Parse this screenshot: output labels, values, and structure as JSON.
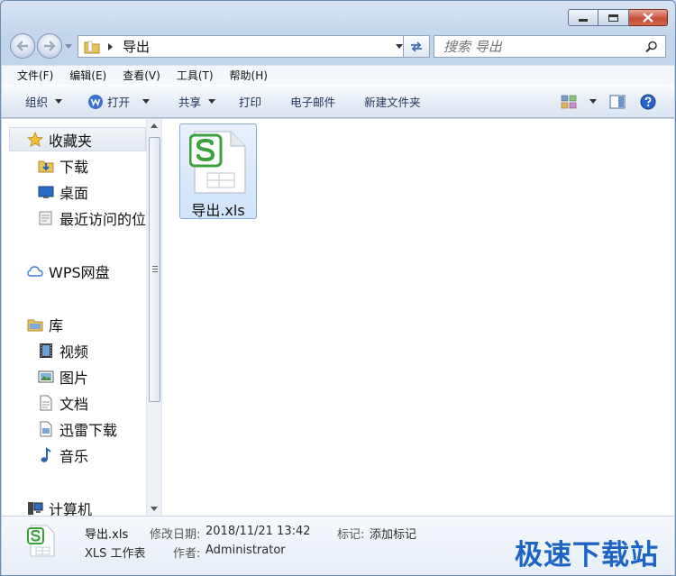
{
  "address": {
    "path": "导出"
  },
  "search": {
    "placeholder": "搜索 导出"
  },
  "menu": [
    "文件(F)",
    "编辑(E)",
    "查看(V)",
    "工具(T)",
    "帮助(H)"
  ],
  "toolbar": {
    "organize": "组织",
    "open": "打开",
    "share": "共享",
    "print": "打印",
    "email": "电子邮件",
    "new_folder": "新建文件夹"
  },
  "nav": {
    "favorites": "收藏夹",
    "downloads": "下载",
    "desktop": "桌面",
    "recent": "最近访问的位",
    "wps_cloud": "WPS网盘",
    "libraries": "库",
    "videos": "视频",
    "pictures": "图片",
    "documents": "文档",
    "thunder": "迅雷下载",
    "music": "音乐",
    "computer": "计算机"
  },
  "files": [
    {
      "name": "导出.xls"
    }
  ],
  "details": {
    "name": "导出.xls",
    "type": "XLS 工作表",
    "modified_label": "修改日期:",
    "modified": "2018/11/21 13:42",
    "author_label": "作者:",
    "author": "Administrator",
    "tags_label": "标记:",
    "tags": "添加标记"
  },
  "watermark": "极速下载站",
  "colors": {
    "wps_green": "#3aa13d",
    "selection": "#cfe3fa",
    "watermark": "#1d64c4"
  }
}
